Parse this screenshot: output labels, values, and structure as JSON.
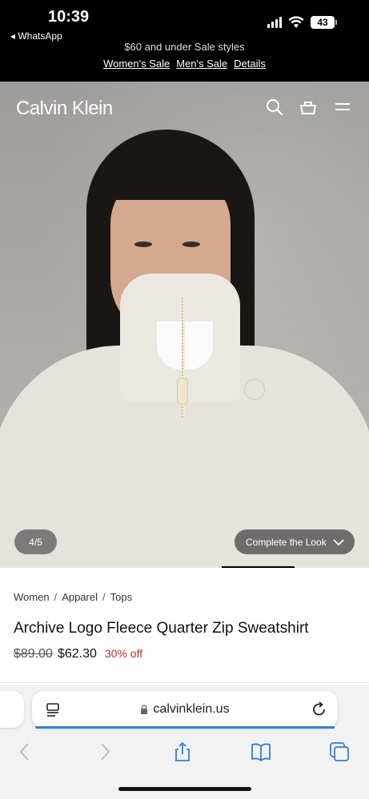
{
  "status_bar": {
    "time": "10:39",
    "back_app": "◂ WhatsApp",
    "battery": "43"
  },
  "promo": {
    "cut_text": "$60 and under Sale styles",
    "links": [
      "Women's Sale",
      "Men's Sale",
      "Details"
    ]
  },
  "header": {
    "brand": "Calvin Klein"
  },
  "gallery": {
    "pager": "4/5",
    "complete_look": "Complete the Look",
    "progress": 0.8
  },
  "breadcrumb": {
    "items": [
      "Women",
      "Apparel",
      "Tops"
    ],
    "separator": "/"
  },
  "product": {
    "title": "Archive Logo Fleece Quarter Zip Sweatshirt",
    "old_price": "$89.00",
    "new_price": "$62.30",
    "discount": "30% off"
  },
  "browser": {
    "url": "calvinklein.us"
  },
  "colors": {
    "sale_red": "#c52a2a",
    "safari_blue": "#2f7fe0"
  }
}
